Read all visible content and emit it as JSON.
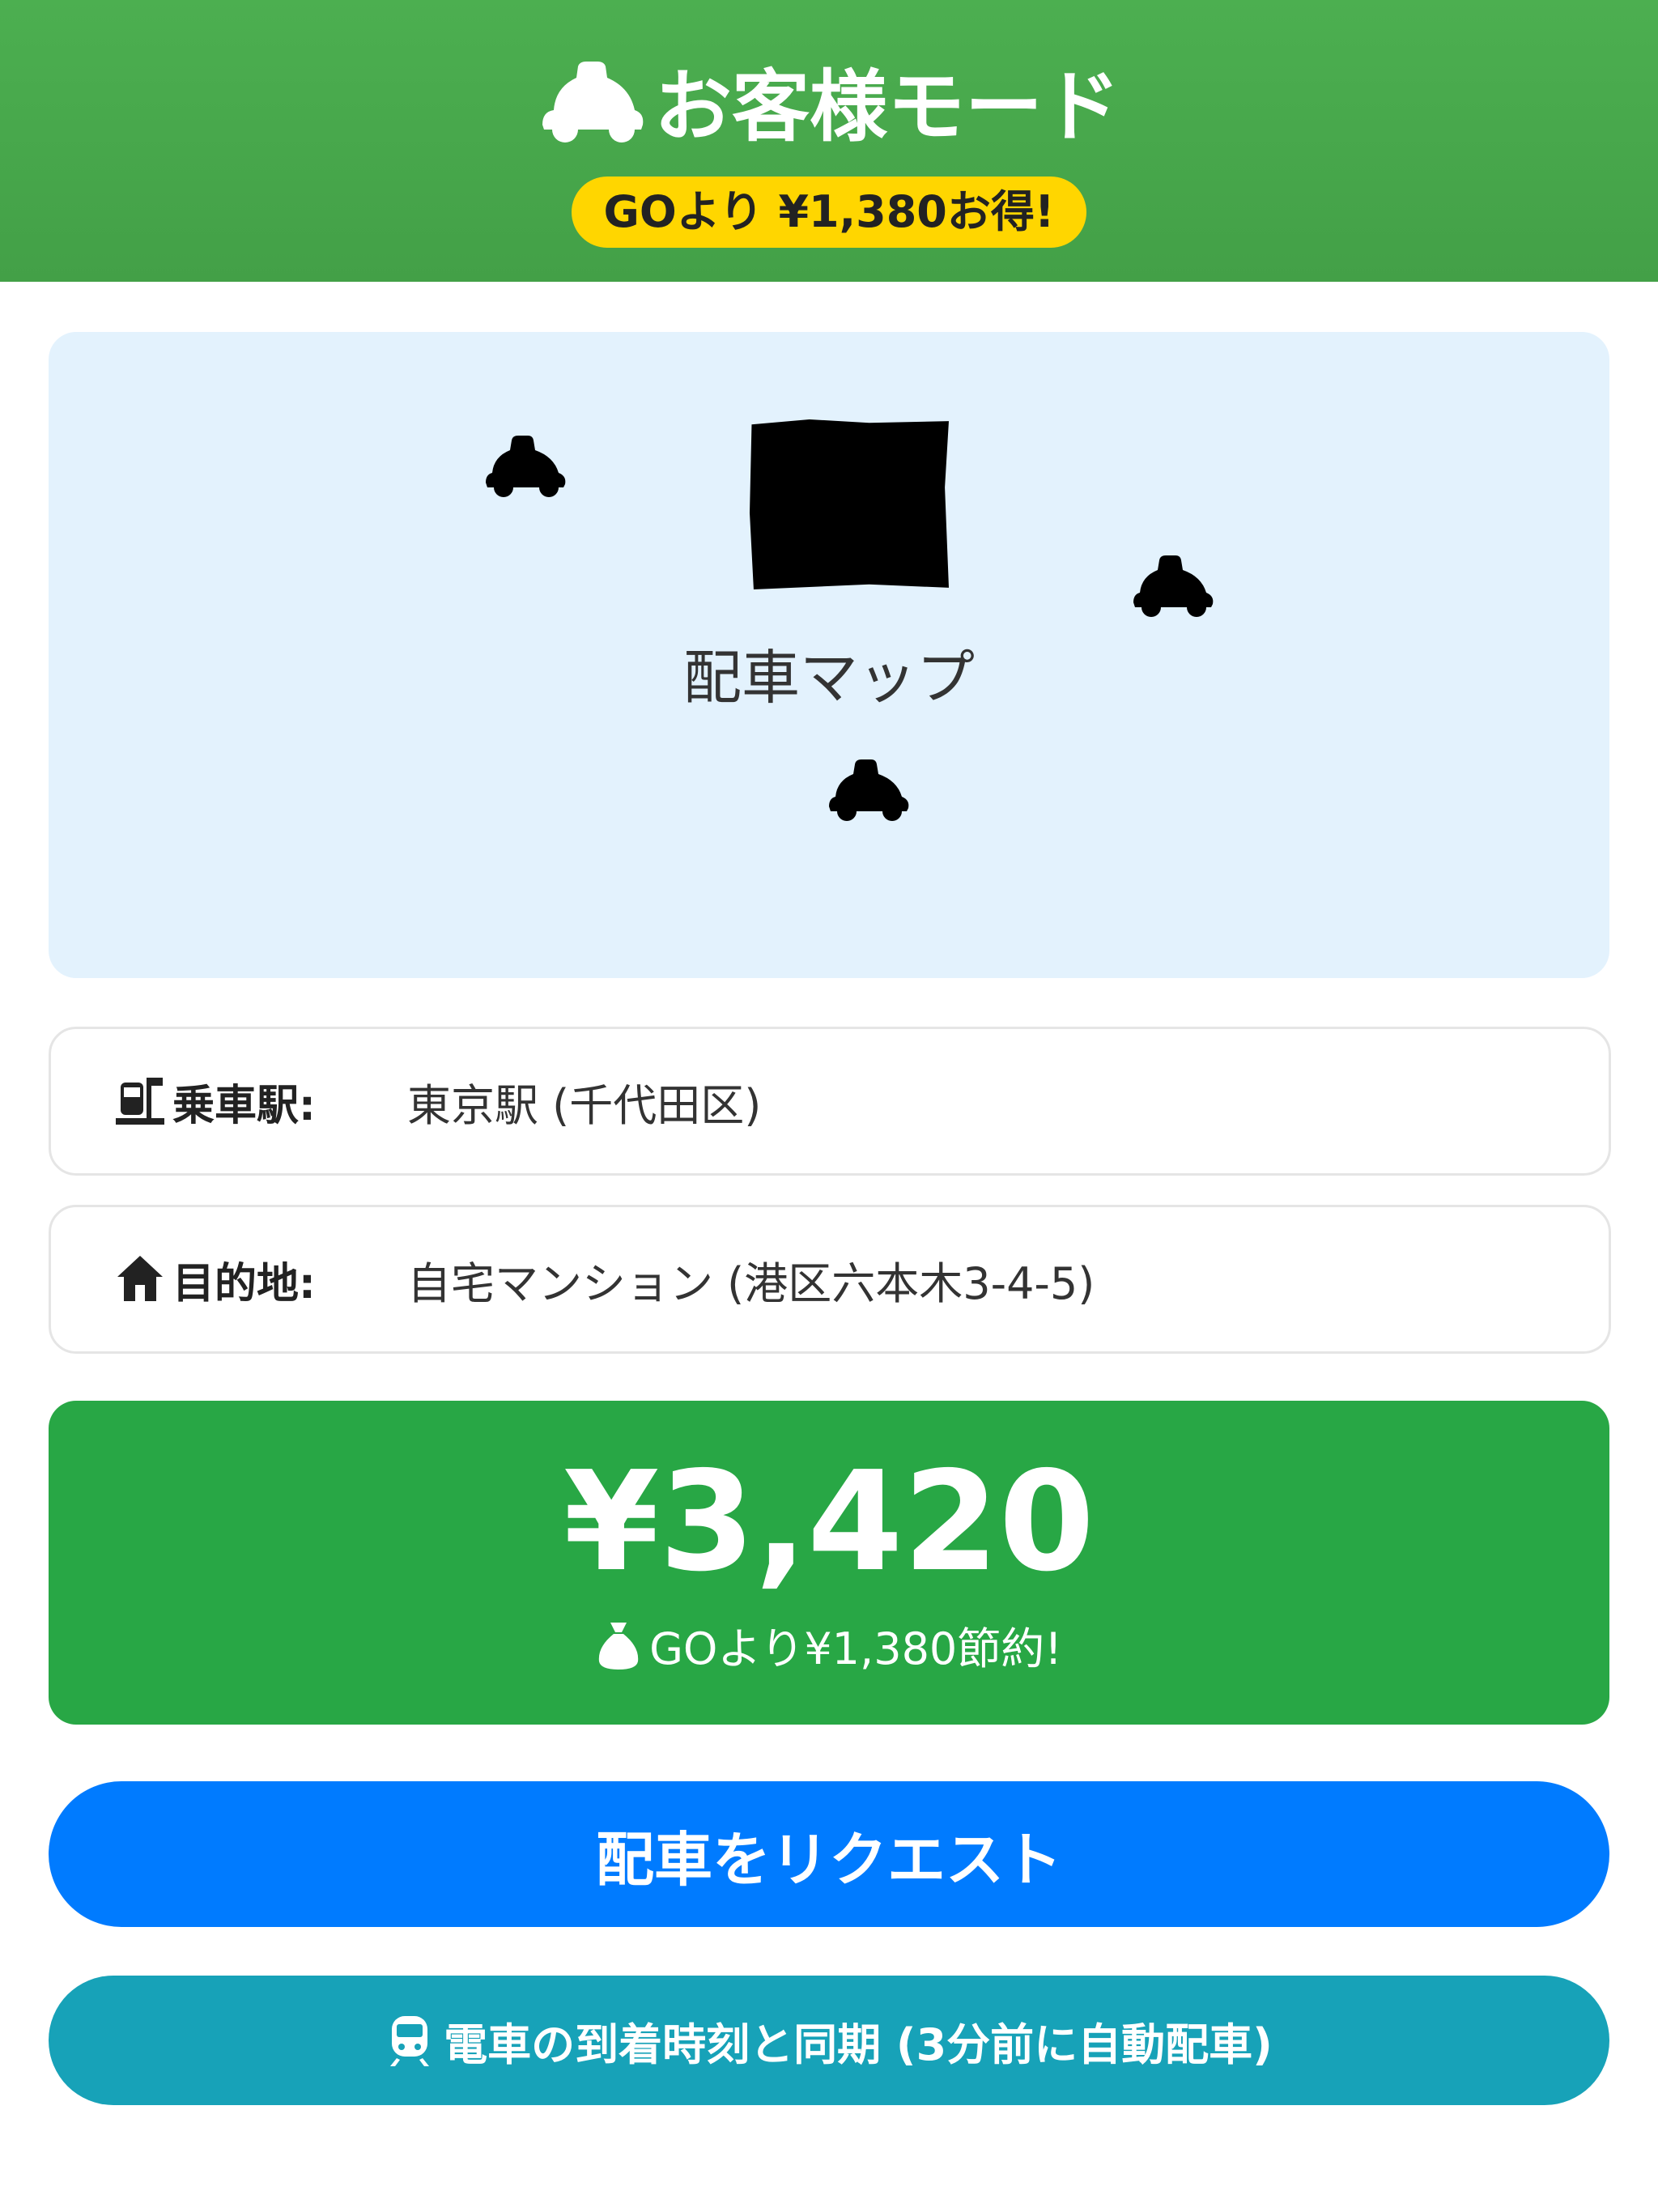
{
  "header": {
    "title": "お客様モード",
    "title_icon": "taxi-icon",
    "promo": "GOより ¥1,380お得!",
    "bg_color": "#4CAF50",
    "promo_color": "#FFD600"
  },
  "map": {
    "label": "配車マップ",
    "bg_color": "#E3F2FD",
    "car_icon": "taxi-icon"
  },
  "pickup": {
    "icon": "train-station-icon",
    "label": "乗車駅:",
    "value": "東京駅 (千代田区)"
  },
  "destination": {
    "icon": "house-icon",
    "label": "目的地:",
    "value": "自宅マンション (港区六本木3-4-5)"
  },
  "fare": {
    "amount": "¥3,420",
    "saving_icon": "money-bag-icon",
    "saving": "GOより¥1,380節約!",
    "bg_color": "#28A745"
  },
  "buttons": {
    "request": "配車をリクエスト",
    "request_color": "#007BFF",
    "sync_icon": "train-icon",
    "sync": "電車の到着時刻と同期 (3分前に自動配車)",
    "sync_color": "#17A2B8"
  }
}
